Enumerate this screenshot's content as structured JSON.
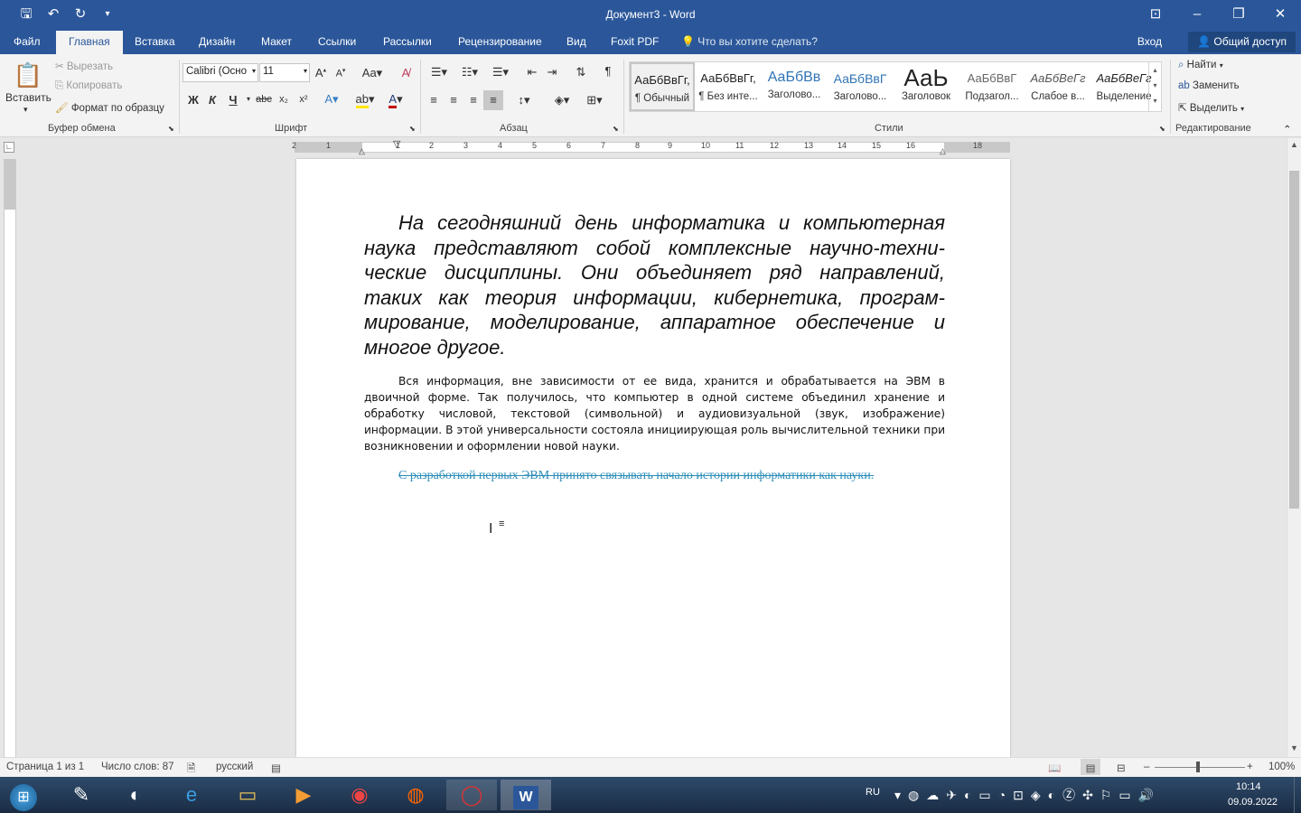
{
  "window": {
    "title": "Документ3 - Word"
  },
  "qat": {
    "save_icon": "save-icon",
    "undo_icon": "undo-icon",
    "redo_icon": "redo-icon"
  },
  "tabs": [
    {
      "label": "Файл"
    },
    {
      "label": "Главная"
    },
    {
      "label": "Вставка"
    },
    {
      "label": "Дизайн"
    },
    {
      "label": "Макет"
    },
    {
      "label": "Ссылки"
    },
    {
      "label": "Рассылки"
    },
    {
      "label": "Рецензирование"
    },
    {
      "label": "Вид"
    },
    {
      "label": "Foxit PDF"
    }
  ],
  "tell_me": "Что вы хотите сделать?",
  "signin": "Вход",
  "share": "Общий доступ",
  "clipboard": {
    "paste": "Вставить",
    "cut": "Вырезать",
    "copy": "Копировать",
    "format_painter": "Формат по образцу",
    "group": "Буфер обмена"
  },
  "font": {
    "name": "Calibri (Осно",
    "size": "11",
    "group": "Шрифт",
    "bold": "Ж",
    "italic": "К",
    "underline": "Ч"
  },
  "paragraph": {
    "group": "Абзац"
  },
  "styles": {
    "group": "Стили",
    "items": [
      {
        "preview": "АаБбВвГг,",
        "name": "¶ Обычный"
      },
      {
        "preview": "АаБбВвГг,",
        "name": "¶ Без инте..."
      },
      {
        "preview": "АаБбВв",
        "name": "Заголово..."
      },
      {
        "preview": "АаБбВвГ",
        "name": "Заголово..."
      },
      {
        "preview": "АаЬ",
        "name": "Заголовок"
      },
      {
        "preview": "АаБбВвГ",
        "name": "Подзагол..."
      },
      {
        "preview": "АаБбВеГг",
        "name": "Слабое в..."
      },
      {
        "preview": "АаБбВеГг",
        "name": "Выделение"
      }
    ]
  },
  "editing": {
    "find": "Найти",
    "replace": "Заменить",
    "select": "Выделить",
    "group": "Редактирование"
  },
  "ruler": {
    "numbers": [
      "2",
      "1",
      "1",
      "2",
      "3",
      "4",
      "5",
      "6",
      "7",
      "8",
      "9",
      "10",
      "11",
      "12",
      "13",
      "14",
      "15",
      "16",
      "18"
    ]
  },
  "document": {
    "p1": "На сегодняшний день информатика и компьютерная наука представляют собой комплексные научно-техни-ческие дисциплины. Они объединяет ряд направлений, таких как теория информации, кибернетика, програм-мирование, моделирование, аппаратное обеспечение и многое другое.",
    "p2": "Вся информация, вне зависимости от ее вида, хранится и обрабатывается на ЭВМ в двоичной форме. Так получилось, что компьютер в одной системе объединил хранение и обработку числовой, текстовой (символьной) и аудиовизуальной (звук, изображение) информации. В этой универсальности состояла инициирующая роль вычислительной техники при возникновении и оформлении новой науки.",
    "p3": "С разработкой первых ЭВМ принято связывать начало истории информатики как науки."
  },
  "status": {
    "page": "Страница 1 из 1",
    "words": "Число слов: 87",
    "language": "русский",
    "zoom": "100%"
  },
  "tray": {
    "lang": "RU",
    "time": "10:14",
    "date": "09.09.2022"
  }
}
